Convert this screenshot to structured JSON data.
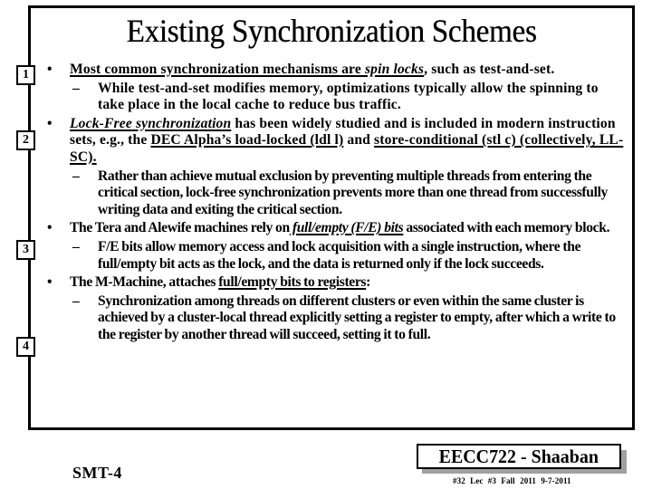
{
  "slide": {
    "title": "Existing Synchronization Schemes",
    "markers": [
      "1",
      "2",
      "3",
      "4"
    ],
    "bullet_glyph": "•",
    "dash_glyph": "–",
    "items": [
      {
        "level": 1,
        "marker": "1",
        "parts": [
          {
            "text": "Most common synchronization mechanisms  are ",
            "underline": true
          },
          {
            "text": "spin locks",
            "underline": true,
            "italic": true
          },
          {
            "text": ", such as test-and-set."
          }
        ]
      },
      {
        "level": 2,
        "parts": [
          {
            "text": "While test-and-set modifies memory, optimizations typically allow the spinning to take place in the local cache to reduce bus traffic."
          }
        ]
      },
      {
        "level": 1,
        "marker": "2",
        "parts": [
          {
            "text": "Lock-Free synchronization",
            "underline": true,
            "italic": true
          },
          {
            "text": " has been widely studied  and is included in modern instruction sets, e.g., the "
          },
          {
            "text": "DEC Alpha’s load-locked (ldl l)",
            "underline": true
          },
          {
            "text": " and "
          },
          {
            "text": "store-conditional (stl c) (collectively, LL-SC).",
            "underline": true
          }
        ]
      },
      {
        "level": 2,
        "parts": [
          {
            "text": "Rather than achieve mutual exclusion by preventing multiple threads from entering the critical section, lock-free synchronization prevents more than one thread from successfully writing data and exiting the critical section."
          }
        ]
      },
      {
        "level": 1,
        "marker": "3",
        "parts": [
          {
            "text": "The Tera  and Alewife machines rely on"
          },
          {
            "text": " full/empty (F/E) bits",
            "underline": true,
            "italic": true
          },
          {
            "text": " associated with each memory block."
          }
        ]
      },
      {
        "level": 2,
        "parts": [
          {
            "text": "F/E bits allow memory access and lock acquisition with a single instruction, where the full/empty bit acts as the lock, and the data is returned only if the lock succeeds."
          }
        ]
      },
      {
        "level": 1,
        "marker": "4",
        "parts": [
          {
            "text": "The M-Machine, attaches "
          },
          {
            "text": "full/empty bits to registers",
            "underline": true
          },
          {
            "text": ":"
          }
        ]
      },
      {
        "level": 2,
        "parts": [
          {
            "text": "Synchronization among threads on different clusters or even within the same cluster is achieved by a cluster-local thread explicitly setting a register to empty, after which a write to the register by another thread will succeed, setting it to full."
          }
        ]
      }
    ]
  },
  "footer": {
    "left_label": "SMT-4",
    "badge_label": "EECC722 - Shaaban",
    "slide_info": "#32  Lec #3  Fall 2011  9-7-2011"
  },
  "colors": {
    "text": "#000000",
    "background": "#ffffff",
    "badge_shadow": "#a0a0a0"
  }
}
